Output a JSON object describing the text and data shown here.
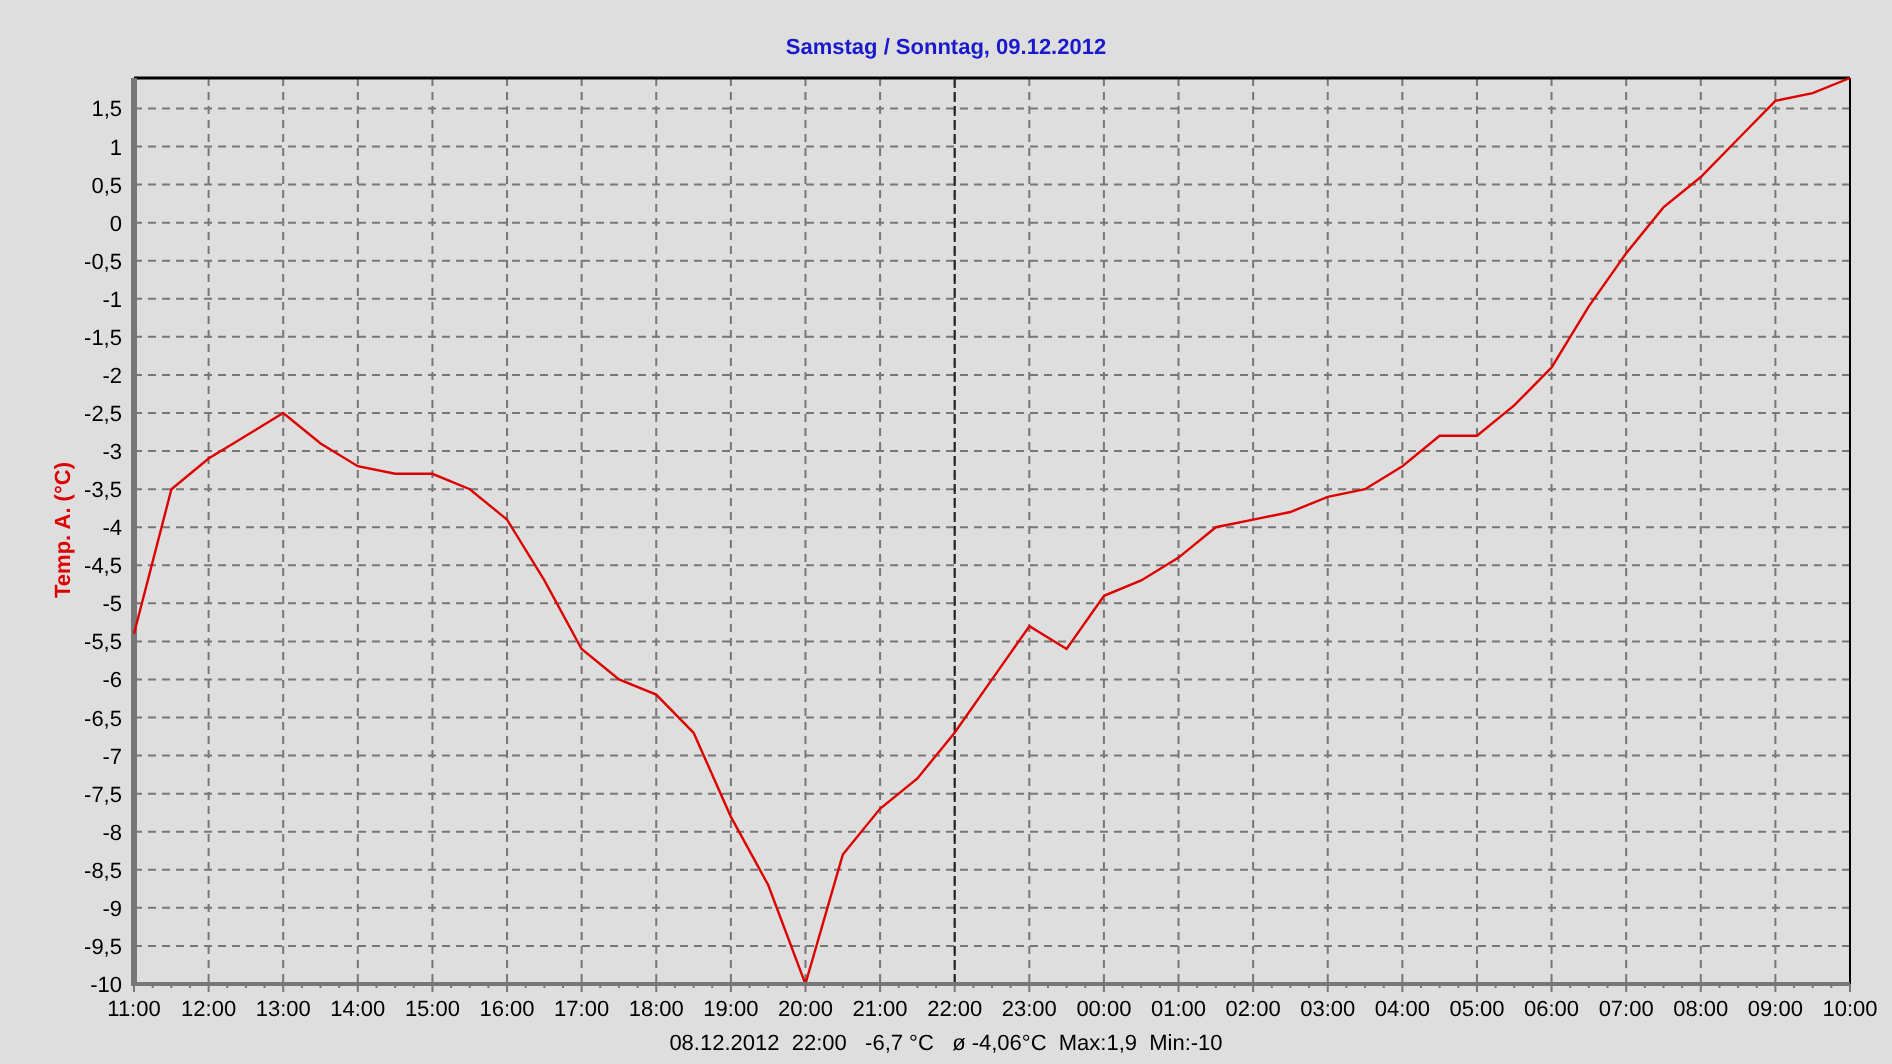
{
  "chart": {
    "chart_data": {
      "type": "line",
      "title": "Samstag / Sonntag, 09.12.2012",
      "ylabel": "Temp. A. (°C)",
      "categories": [
        "11:00",
        null,
        "12:00",
        null,
        "13:00",
        null,
        "14:00",
        null,
        "15:00",
        null,
        "16:00",
        null,
        "17:00",
        null,
        "18:00",
        null,
        "19:00",
        null,
        "20:00",
        null,
        "21:00",
        null,
        "22:00",
        null,
        "23:00",
        null,
        "00:00",
        null,
        "01:00",
        null,
        "02:00",
        null,
        "03:00",
        null,
        "04:00",
        null,
        "05:00",
        null,
        "06:00",
        null,
        "07:00",
        null,
        "08:00",
        null,
        "09:00",
        null,
        "10:00"
      ],
      "series": [
        {
          "color": "#dd0000",
          "values": [
            -5.4,
            -3.5,
            -3.1,
            -2.8,
            -2.5,
            -2.9,
            -3.2,
            -3.3,
            -3.3,
            -3.5,
            -3.9,
            -4.7,
            -5.6,
            -6.0,
            -6.2,
            -6.7,
            -7.8,
            -8.7,
            -10,
            -8.3,
            -7.7,
            -7.3,
            -6.7,
            -6.0,
            -5.3,
            -5.6,
            -4.9,
            -4.7,
            -4.4,
            -4.0,
            -3.9,
            -3.8,
            -3.6,
            -3.5,
            -3.2,
            -2.8,
            -2.8,
            -2.4,
            -1.9,
            -1.1,
            -0.4,
            0.2,
            0.6,
            1.1,
            1.6,
            1.7,
            1.9
          ]
        }
      ],
      "ylim": [
        -10,
        1.9
      ],
      "yticks": [
        {
          "value": 1.5,
          "label": "1,5"
        },
        {
          "value": 1,
          "label": "1"
        },
        {
          "value": 0.5,
          "label": "0,5"
        },
        {
          "value": 0,
          "label": "0"
        },
        {
          "value": -0.5,
          "label": "-0,5"
        },
        {
          "value": -1,
          "label": "-1"
        },
        {
          "value": -1.5,
          "label": "-1,5"
        },
        {
          "value": -2,
          "label": "-2"
        },
        {
          "value": -2.5,
          "label": "-2,5"
        },
        {
          "value": -3,
          "label": "-3"
        },
        {
          "value": -3.5,
          "label": "-3,5"
        },
        {
          "value": -4,
          "label": "-4"
        },
        {
          "value": -4.5,
          "label": "-4,5"
        },
        {
          "value": -5,
          "label": "-5"
        },
        {
          "value": -5.5,
          "label": "-5,5"
        },
        {
          "value": -6,
          "label": "-6"
        },
        {
          "value": -6.5,
          "label": "-6,5"
        },
        {
          "value": -7,
          "label": "-7"
        },
        {
          "value": -7.5,
          "label": "-7,5"
        },
        {
          "value": -8,
          "label": "-8"
        },
        {
          "value": -8.5,
          "label": "-8,5"
        },
        {
          "value": -9,
          "label": "-9"
        },
        {
          "value": -9.5,
          "label": "-9,5"
        },
        {
          "value": -10,
          "label": "-10"
        }
      ],
      "grid": true,
      "ref_lines": [
        {
          "axis": "x",
          "value": "22:00"
        }
      ]
    },
    "status": "08.12.2012  22:00   -6,7 °C   ø -4,06°C  Max:1,9  Min:-10"
  }
}
